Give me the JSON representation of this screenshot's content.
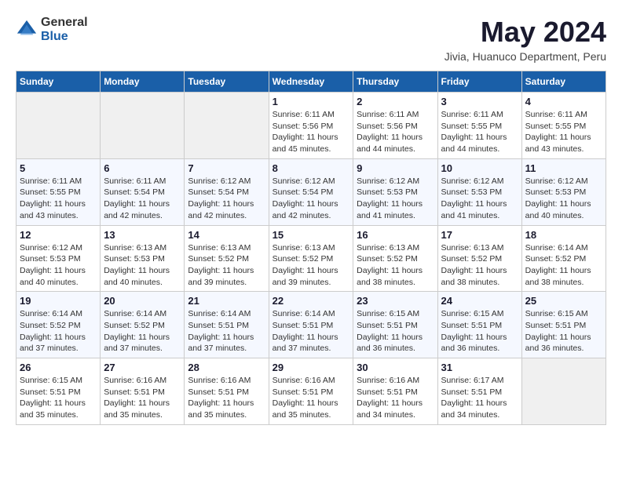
{
  "logo": {
    "general": "General",
    "blue": "Blue"
  },
  "title": {
    "month_year": "May 2024",
    "location": "Jivia, Huanuco Department, Peru"
  },
  "headers": [
    "Sunday",
    "Monday",
    "Tuesday",
    "Wednesday",
    "Thursday",
    "Friday",
    "Saturday"
  ],
  "weeks": [
    [
      {
        "day": "",
        "empty": true
      },
      {
        "day": "",
        "empty": true
      },
      {
        "day": "",
        "empty": true
      },
      {
        "day": "1",
        "sunrise": "Sunrise: 6:11 AM",
        "sunset": "Sunset: 5:56 PM",
        "daylight": "Daylight: 11 hours and 45 minutes."
      },
      {
        "day": "2",
        "sunrise": "Sunrise: 6:11 AM",
        "sunset": "Sunset: 5:56 PM",
        "daylight": "Daylight: 11 hours and 44 minutes."
      },
      {
        "day": "3",
        "sunrise": "Sunrise: 6:11 AM",
        "sunset": "Sunset: 5:55 PM",
        "daylight": "Daylight: 11 hours and 44 minutes."
      },
      {
        "day": "4",
        "sunrise": "Sunrise: 6:11 AM",
        "sunset": "Sunset: 5:55 PM",
        "daylight": "Daylight: 11 hours and 43 minutes."
      }
    ],
    [
      {
        "day": "5",
        "sunrise": "Sunrise: 6:11 AM",
        "sunset": "Sunset: 5:55 PM",
        "daylight": "Daylight: 11 hours and 43 minutes."
      },
      {
        "day": "6",
        "sunrise": "Sunrise: 6:11 AM",
        "sunset": "Sunset: 5:54 PM",
        "daylight": "Daylight: 11 hours and 42 minutes."
      },
      {
        "day": "7",
        "sunrise": "Sunrise: 6:12 AM",
        "sunset": "Sunset: 5:54 PM",
        "daylight": "Daylight: 11 hours and 42 minutes."
      },
      {
        "day": "8",
        "sunrise": "Sunrise: 6:12 AM",
        "sunset": "Sunset: 5:54 PM",
        "daylight": "Daylight: 11 hours and 42 minutes."
      },
      {
        "day": "9",
        "sunrise": "Sunrise: 6:12 AM",
        "sunset": "Sunset: 5:53 PM",
        "daylight": "Daylight: 11 hours and 41 minutes."
      },
      {
        "day": "10",
        "sunrise": "Sunrise: 6:12 AM",
        "sunset": "Sunset: 5:53 PM",
        "daylight": "Daylight: 11 hours and 41 minutes."
      },
      {
        "day": "11",
        "sunrise": "Sunrise: 6:12 AM",
        "sunset": "Sunset: 5:53 PM",
        "daylight": "Daylight: 11 hours and 40 minutes."
      }
    ],
    [
      {
        "day": "12",
        "sunrise": "Sunrise: 6:12 AM",
        "sunset": "Sunset: 5:53 PM",
        "daylight": "Daylight: 11 hours and 40 minutes."
      },
      {
        "day": "13",
        "sunrise": "Sunrise: 6:13 AM",
        "sunset": "Sunset: 5:53 PM",
        "daylight": "Daylight: 11 hours and 40 minutes."
      },
      {
        "day": "14",
        "sunrise": "Sunrise: 6:13 AM",
        "sunset": "Sunset: 5:52 PM",
        "daylight": "Daylight: 11 hours and 39 minutes."
      },
      {
        "day": "15",
        "sunrise": "Sunrise: 6:13 AM",
        "sunset": "Sunset: 5:52 PM",
        "daylight": "Daylight: 11 hours and 39 minutes."
      },
      {
        "day": "16",
        "sunrise": "Sunrise: 6:13 AM",
        "sunset": "Sunset: 5:52 PM",
        "daylight": "Daylight: 11 hours and 38 minutes."
      },
      {
        "day": "17",
        "sunrise": "Sunrise: 6:13 AM",
        "sunset": "Sunset: 5:52 PM",
        "daylight": "Daylight: 11 hours and 38 minutes."
      },
      {
        "day": "18",
        "sunrise": "Sunrise: 6:14 AM",
        "sunset": "Sunset: 5:52 PM",
        "daylight": "Daylight: 11 hours and 38 minutes."
      }
    ],
    [
      {
        "day": "19",
        "sunrise": "Sunrise: 6:14 AM",
        "sunset": "Sunset: 5:52 PM",
        "daylight": "Daylight: 11 hours and 37 minutes."
      },
      {
        "day": "20",
        "sunrise": "Sunrise: 6:14 AM",
        "sunset": "Sunset: 5:52 PM",
        "daylight": "Daylight: 11 hours and 37 minutes."
      },
      {
        "day": "21",
        "sunrise": "Sunrise: 6:14 AM",
        "sunset": "Sunset: 5:51 PM",
        "daylight": "Daylight: 11 hours and 37 minutes."
      },
      {
        "day": "22",
        "sunrise": "Sunrise: 6:14 AM",
        "sunset": "Sunset: 5:51 PM",
        "daylight": "Daylight: 11 hours and 37 minutes."
      },
      {
        "day": "23",
        "sunrise": "Sunrise: 6:15 AM",
        "sunset": "Sunset: 5:51 PM",
        "daylight": "Daylight: 11 hours and 36 minutes."
      },
      {
        "day": "24",
        "sunrise": "Sunrise: 6:15 AM",
        "sunset": "Sunset: 5:51 PM",
        "daylight": "Daylight: 11 hours and 36 minutes."
      },
      {
        "day": "25",
        "sunrise": "Sunrise: 6:15 AM",
        "sunset": "Sunset: 5:51 PM",
        "daylight": "Daylight: 11 hours and 36 minutes."
      }
    ],
    [
      {
        "day": "26",
        "sunrise": "Sunrise: 6:15 AM",
        "sunset": "Sunset: 5:51 PM",
        "daylight": "Daylight: 11 hours and 35 minutes."
      },
      {
        "day": "27",
        "sunrise": "Sunrise: 6:16 AM",
        "sunset": "Sunset: 5:51 PM",
        "daylight": "Daylight: 11 hours and 35 minutes."
      },
      {
        "day": "28",
        "sunrise": "Sunrise: 6:16 AM",
        "sunset": "Sunset: 5:51 PM",
        "daylight": "Daylight: 11 hours and 35 minutes."
      },
      {
        "day": "29",
        "sunrise": "Sunrise: 6:16 AM",
        "sunset": "Sunset: 5:51 PM",
        "daylight": "Daylight: 11 hours and 35 minutes."
      },
      {
        "day": "30",
        "sunrise": "Sunrise: 6:16 AM",
        "sunset": "Sunset: 5:51 PM",
        "daylight": "Daylight: 11 hours and 34 minutes."
      },
      {
        "day": "31",
        "sunrise": "Sunrise: 6:17 AM",
        "sunset": "Sunset: 5:51 PM",
        "daylight": "Daylight: 11 hours and 34 minutes."
      },
      {
        "day": "",
        "empty": true
      }
    ]
  ]
}
